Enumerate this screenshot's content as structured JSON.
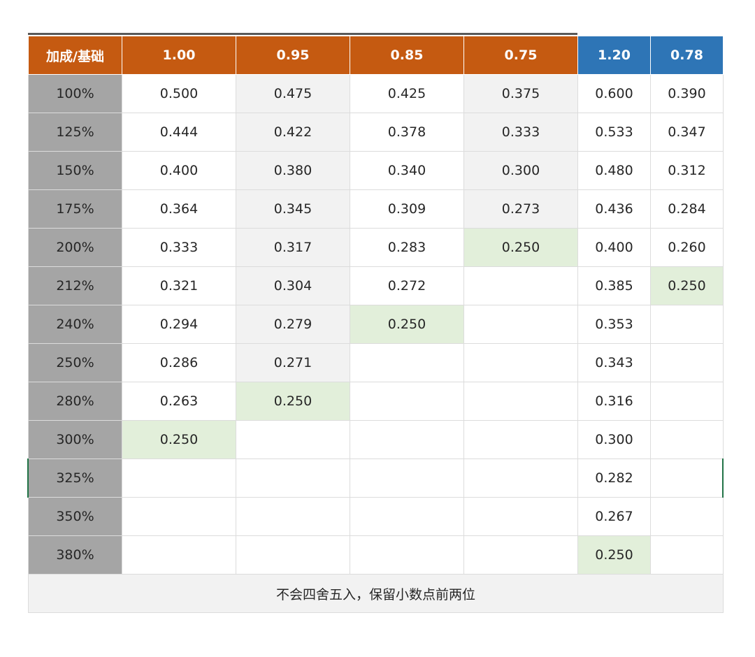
{
  "header": {
    "corner": "加成/基础",
    "columns": [
      "1.00",
      "0.95",
      "0.85",
      "0.75",
      "1.20",
      "0.78"
    ]
  },
  "rows": [
    {
      "label": "100%",
      "cells": [
        "0.500",
        "0.475",
        "0.425",
        "0.375",
        "0.600",
        "0.390"
      ]
    },
    {
      "label": "125%",
      "cells": [
        "0.444",
        "0.422",
        "0.378",
        "0.333",
        "0.533",
        "0.347"
      ]
    },
    {
      "label": "150%",
      "cells": [
        "0.400",
        "0.380",
        "0.340",
        "0.300",
        "0.480",
        "0.312"
      ]
    },
    {
      "label": "175%",
      "cells": [
        "0.364",
        "0.345",
        "0.309",
        "0.273",
        "0.436",
        "0.284"
      ]
    },
    {
      "label": "200%",
      "cells": [
        "0.333",
        "0.317",
        "0.283",
        "0.250",
        "0.400",
        "0.260"
      ]
    },
    {
      "label": "212%",
      "cells": [
        "0.321",
        "0.304",
        "0.272",
        "",
        "0.385",
        "0.250"
      ]
    },
    {
      "label": "240%",
      "cells": [
        "0.294",
        "0.279",
        "0.250",
        "",
        "0.353",
        ""
      ]
    },
    {
      "label": "250%",
      "cells": [
        "0.286",
        "0.271",
        "",
        "",
        "0.343",
        ""
      ]
    },
    {
      "label": "280%",
      "cells": [
        "0.263",
        "0.250",
        "",
        "",
        "0.316",
        ""
      ]
    },
    {
      "label": "300%",
      "cells": [
        "0.250",
        "",
        "",
        "",
        "0.300",
        ""
      ]
    },
    {
      "label": "325%",
      "cells": [
        "",
        "",
        "",
        "",
        "0.282",
        ""
      ]
    },
    {
      "label": "350%",
      "cells": [
        "",
        "",
        "",
        "",
        "0.267",
        ""
      ]
    },
    {
      "label": "380%",
      "cells": [
        "",
        "",
        "",
        "",
        "0.250",
        ""
      ]
    }
  ],
  "footer": {
    "note": "不会四舍五入，保留小数点前两位"
  },
  "colors": {
    "header_orange": "#c55a11",
    "header_blue": "#2e75b6",
    "row_label_gray": "#a5a5a5",
    "shade_gray": "#f2f2f2",
    "highlight_green": "#e2efda"
  }
}
